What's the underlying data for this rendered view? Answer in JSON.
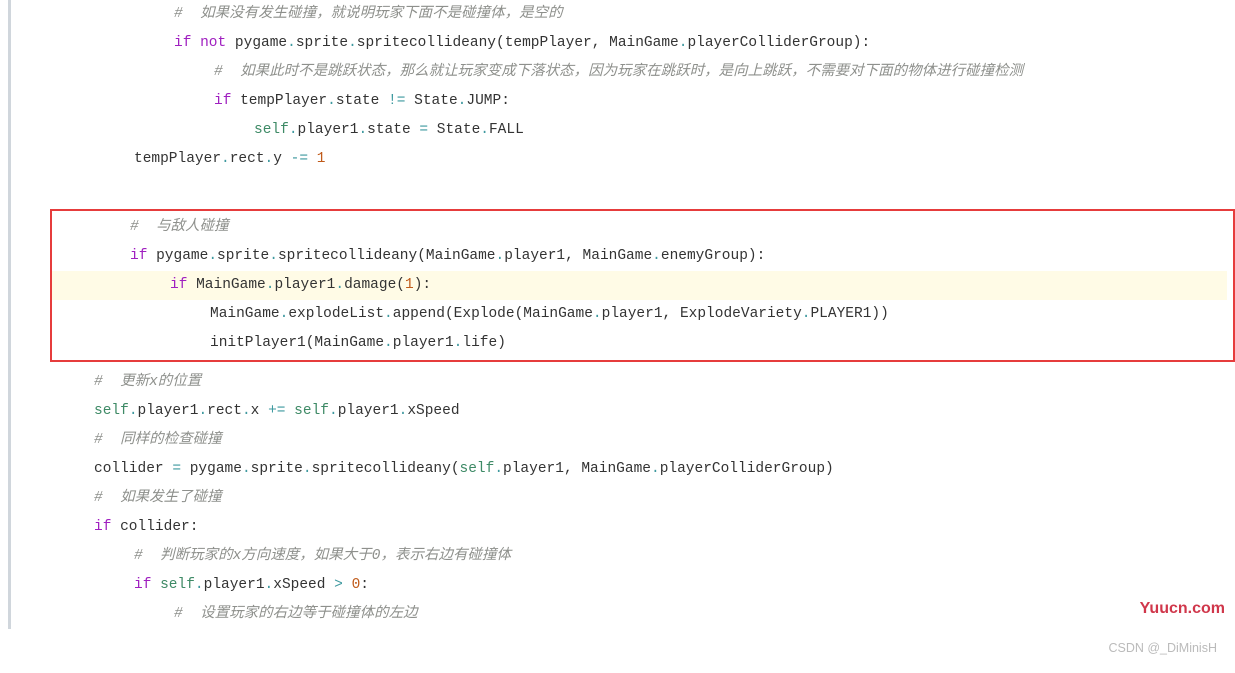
{
  "watermark_top": "Yuucn.com",
  "watermark_bottom": "CSDN @_DiMinisH",
  "comments": {
    "c1": "#  如果没有发生碰撞，就说明玩家下面不是碰撞体，是空的",
    "c2": "#  如果此时不是跳跃状态，那么就让玩家变成下落状态，因为玩家在跳跃时，是向上跳跃，不需要对下面的物体进行碰撞检测",
    "c3": "#  与敌人碰撞",
    "c4": "#  更新x的位置",
    "c5": "#  同样的检查碰撞",
    "c6": "#  如果发生了碰撞",
    "c7": "#  判断玩家的x方向速度，如果大于0，表示右边有碰撞体",
    "c8": "#  设置玩家的右边等于碰撞体的左边"
  },
  "tokens": {
    "if": "if",
    "not": "not",
    "pygame": "pygame",
    "sprite": "sprite",
    "spritecollideany": "spritecollideany",
    "tempPlayer": "tempPlayer",
    "MainGame": "MainGame",
    "playerColliderGroup": "playerColliderGroup",
    "state": "state",
    "State": "State",
    "JUMP": "JUMP",
    "self": "self",
    "player1": "player1",
    "FALL": "FALL",
    "rect": "rect",
    "y": "y",
    "enemyGroup": "enemyGroup",
    "damage": "damage",
    "explodeList": "explodeList",
    "append": "append",
    "Explode": "Explode",
    "ExplodeVariety": "ExplodeVariety",
    "PLAYER1": "PLAYER1",
    "initPlayer1": "initPlayer1",
    "life": "life",
    "x": "x",
    "xSpeed": "xSpeed",
    "collider": "collider",
    "num1": "1",
    "num0": "0",
    "op_ne": "!=",
    "op_eq": "=",
    "op_sub": "-=",
    "op_add": "+=",
    "op_gt": ">"
  }
}
